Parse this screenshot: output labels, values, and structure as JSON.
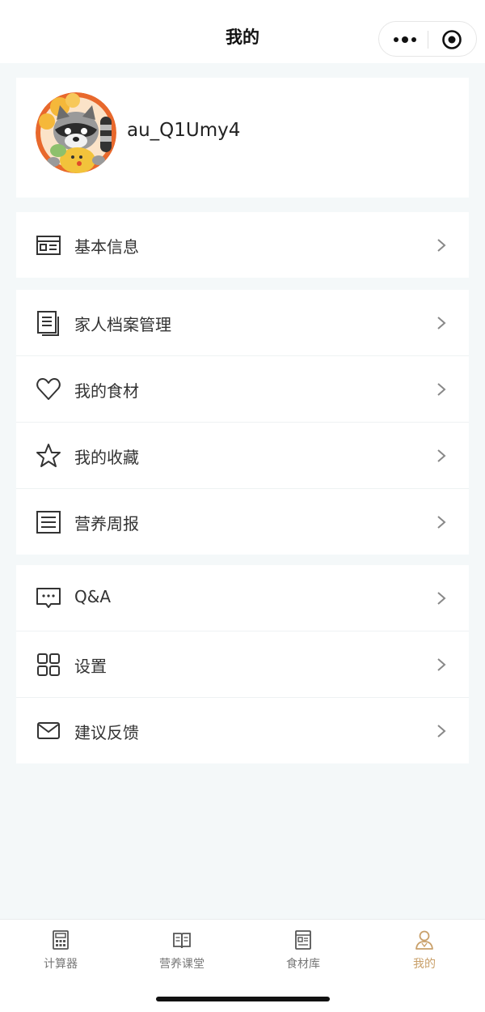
{
  "header": {
    "title": "我的"
  },
  "profile": {
    "username": "au_Q1Umy4"
  },
  "menu_groups": [
    [
      {
        "label": "基本信息",
        "icon": "id-card-icon"
      }
    ],
    [
      {
        "label": "家人档案管理",
        "icon": "document-icon"
      },
      {
        "label": "我的食材",
        "icon": "heart-icon"
      },
      {
        "label": "我的收藏",
        "icon": "star-icon"
      },
      {
        "label": "营养周报",
        "icon": "report-icon"
      }
    ],
    [
      {
        "label": "Q&A",
        "icon": "chat-icon"
      },
      {
        "label": "设置",
        "icon": "grid-icon"
      },
      {
        "label": "建议反馈",
        "icon": "mail-icon"
      }
    ]
  ],
  "tabbar": [
    {
      "label": "计算器",
      "icon": "calculator-icon"
    },
    {
      "label": "营养课堂",
      "icon": "book-icon"
    },
    {
      "label": "食材库",
      "icon": "food-library-icon"
    },
    {
      "label": "我的",
      "icon": "user-icon",
      "active": true
    }
  ],
  "colors": {
    "accent": "#c9a06a",
    "background": "#f4f8f9"
  }
}
